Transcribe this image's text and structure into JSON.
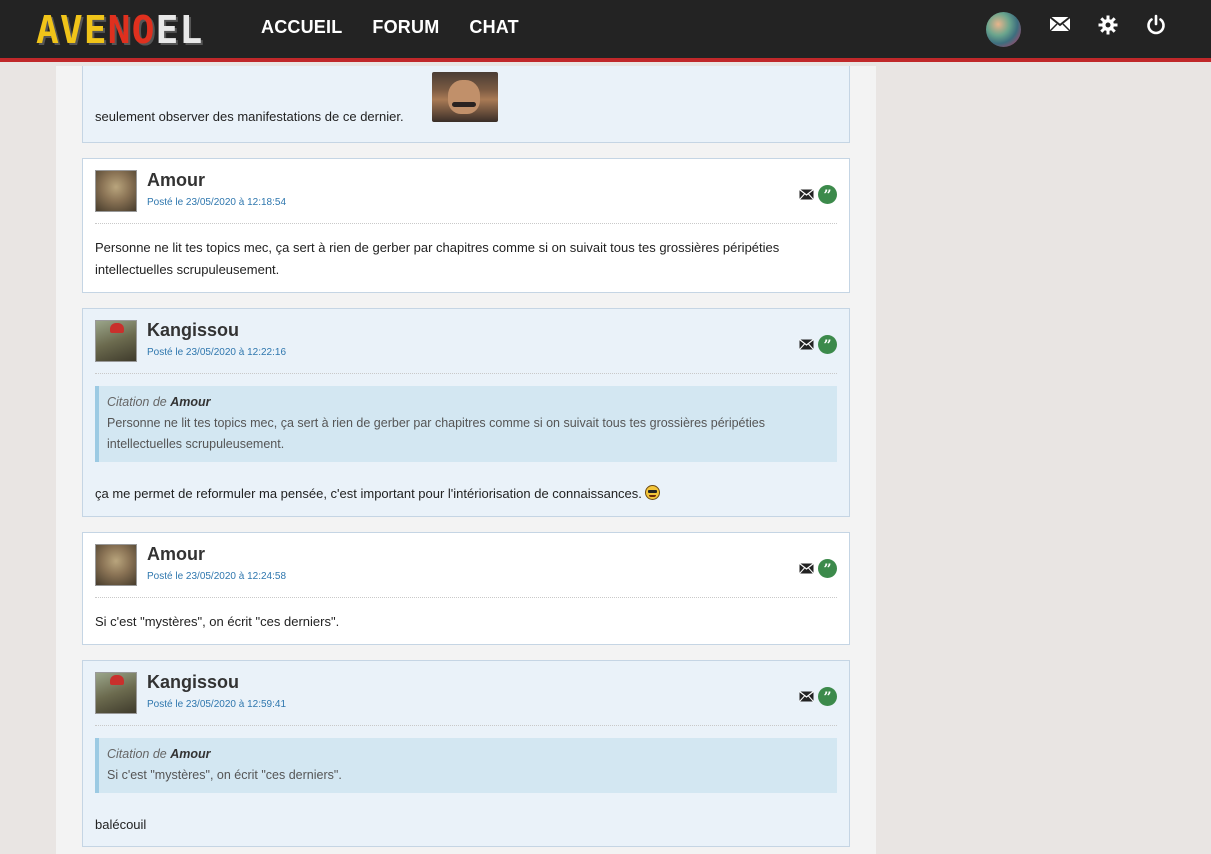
{
  "header": {
    "logo_text": "AVENOEL",
    "nav": [
      "ACCUEIL",
      "FORUM",
      "CHAT"
    ],
    "icons": [
      "user-avatar",
      "mail-icon",
      "gear-icon",
      "power-icon"
    ]
  },
  "first_post": {
    "text": "seulement observer des manifestations de ce dernier."
  },
  "posts": [
    {
      "author": "Amour",
      "date": "Posté le 23/05/2020 à 12:18:54",
      "body": "Personne ne lit tes topics mec, ça sert à rien de gerber par chapitres comme si on suivait tous tes grossières péripéties intellectuelles scrupuleusement."
    },
    {
      "author": "Kangissou",
      "date": "Posté le 23/05/2020 à 12:22:16",
      "quote_prefix": "Citation de",
      "quote_author": "Amour",
      "quote_text": "Personne ne lit tes topics mec, ça sert à rien de gerber par chapitres comme si on suivait tous tes grossières péripéties intellectuelles scrupuleusement.",
      "body": "ça me permet de reformuler ma pensée, c'est important pour l'intériorisation de connaissances."
    },
    {
      "author": "Amour",
      "date": "Posté le 23/05/2020 à 12:24:58",
      "body": "Si c'est \"mystères\", on écrit \"ces derniers\"."
    },
    {
      "author": "Kangissou",
      "date": "Posté le 23/05/2020 à 12:59:41",
      "quote_prefix": "Citation de",
      "quote_author": "Amour",
      "quote_text": "Si c'est \"mystères\", on écrit \"ces derniers\".",
      "body": "balécouil"
    }
  ],
  "colors": {
    "topbar": "#232323",
    "topbar_accent": "#c0282a",
    "date_link": "#2f77ae",
    "quote_button": "#3c8a4b",
    "alt_post_bg": "#eaf2f9",
    "quote_bg": "#d3e7f2"
  }
}
